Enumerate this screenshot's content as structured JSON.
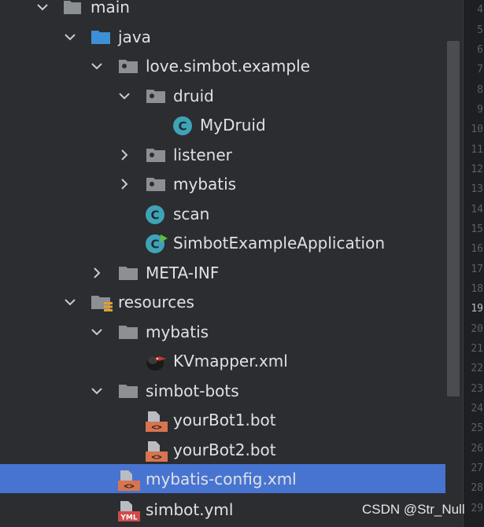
{
  "tree": {
    "items": [
      {
        "label": "main",
        "expanded": true,
        "kind": "folder"
      },
      {
        "label": "java",
        "expanded": true,
        "kind": "source-folder"
      },
      {
        "label": "love.simbot.example",
        "expanded": true,
        "kind": "package"
      },
      {
        "label": "druid",
        "expanded": true,
        "kind": "package"
      },
      {
        "label": "MyDruid",
        "kind": "class"
      },
      {
        "label": "listener",
        "expanded": false,
        "kind": "package"
      },
      {
        "label": "mybatis",
        "expanded": false,
        "kind": "package"
      },
      {
        "label": "scan",
        "kind": "class"
      },
      {
        "label": "SimbotExampleApplication",
        "kind": "spring-boot-class"
      },
      {
        "label": "META-INF",
        "expanded": false,
        "kind": "folder"
      },
      {
        "label": "resources",
        "expanded": true,
        "kind": "resources-folder"
      },
      {
        "label": "mybatis",
        "expanded": true,
        "kind": "folder"
      },
      {
        "label": "KVmapper.xml",
        "kind": "mybatis-mapper-file"
      },
      {
        "label": "simbot-bots",
        "expanded": true,
        "kind": "folder"
      },
      {
        "label": "yourBot1.bot",
        "kind": "xml-like-file"
      },
      {
        "label": "yourBot2.bot",
        "kind": "xml-like-file"
      },
      {
        "label": "mybatis-config.xml",
        "kind": "xml-file",
        "selected": true
      },
      {
        "label": "simbot.yml",
        "kind": "yml-file"
      }
    ]
  },
  "gutter": {
    "line_numbers": [
      "4",
      "5",
      "6",
      "7",
      "8",
      "9",
      "10",
      "11",
      "12",
      "13",
      "14",
      "15",
      "16",
      "17",
      "18",
      "19",
      "20",
      "21",
      "22",
      "23",
      "24",
      "25",
      "26",
      "27",
      "28",
      "29"
    ],
    "active_line": "19"
  },
  "watermark": "CSDN @Str_Null",
  "colors": {
    "background": "#2b2d30",
    "selection": "#4874d1",
    "text": "#dfe1e5",
    "folder": "#8c8f94",
    "source_folder": "#3d8fd6",
    "class_icon": "#3fa3b8",
    "file_orange": "#d8744e"
  }
}
